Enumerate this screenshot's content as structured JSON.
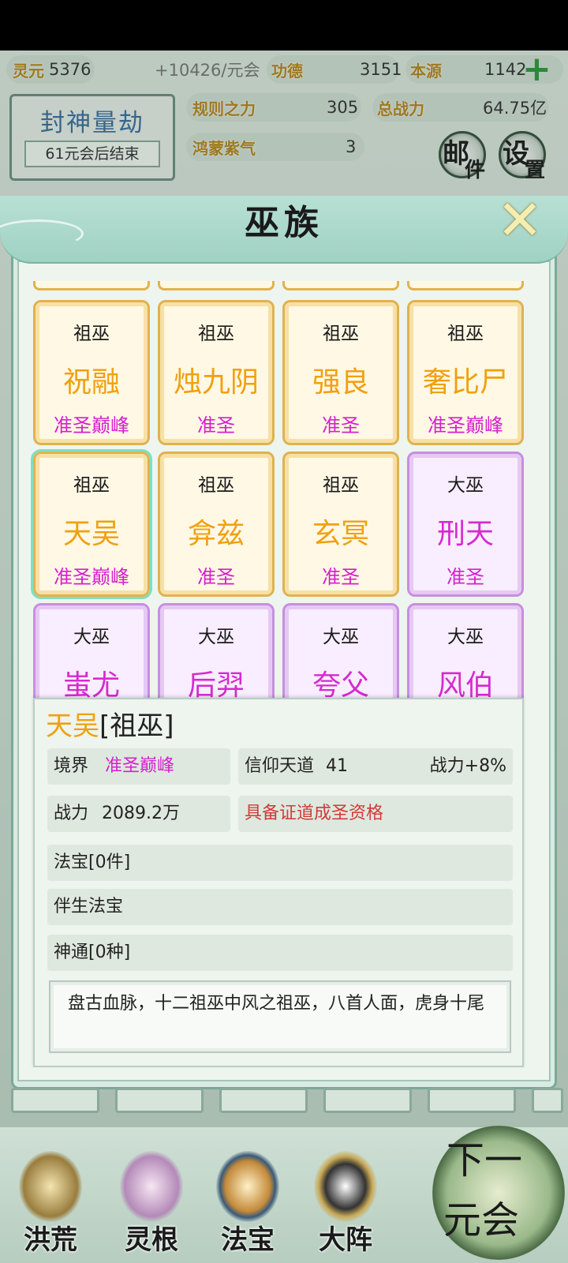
{
  "resources": {
    "lingyuan_label": "灵元",
    "lingyuan_value": "5376",
    "income": "+10426/元会",
    "gongde_label": "功德",
    "gongde_value": "3151",
    "benyuan_label": "本源",
    "benyuan_value": "1142",
    "guize_label": "规则之力",
    "guize_value": "305",
    "zongzhanli_label": "总战力",
    "zongzhanli_value": "64.75亿",
    "hongmeng_label": "鸿蒙紫气",
    "hongmeng_value": "3"
  },
  "event": {
    "title": "封神量劫",
    "subtitle": "61元会后结束"
  },
  "buttons": {
    "mail_top": "邮",
    "mail_bottom": "件",
    "settings_top": "设",
    "settings_bottom": "置",
    "close": "✕",
    "add": "+"
  },
  "modal": {
    "title": "巫族"
  },
  "cards": [
    {
      "rank": "祖巫",
      "name": "祝融",
      "level": "准圣巅峰",
      "tier": "gold"
    },
    {
      "rank": "祖巫",
      "name": "烛九阴",
      "level": "准圣",
      "tier": "gold"
    },
    {
      "rank": "祖巫",
      "name": "强良",
      "level": "准圣",
      "tier": "gold"
    },
    {
      "rank": "祖巫",
      "name": "奢比尸",
      "level": "准圣巅峰",
      "tier": "gold"
    },
    {
      "rank": "祖巫",
      "name": "天吴",
      "level": "准圣巅峰",
      "tier": "gold",
      "selected": true
    },
    {
      "rank": "祖巫",
      "name": "弇兹",
      "level": "准圣",
      "tier": "gold"
    },
    {
      "rank": "祖巫",
      "name": "玄冥",
      "level": "准圣",
      "tier": "gold"
    },
    {
      "rank": "大巫",
      "name": "刑天",
      "level": "准圣",
      "tier": "purple"
    },
    {
      "rank": "大巫",
      "name": "蚩尤",
      "level": "",
      "tier": "purple"
    },
    {
      "rank": "大巫",
      "name": "后羿",
      "level": "",
      "tier": "purple"
    },
    {
      "rank": "大巫",
      "name": "夸父",
      "level": "",
      "tier": "purple"
    },
    {
      "rank": "大巫",
      "name": "风伯",
      "level": "",
      "tier": "purple"
    }
  ],
  "detail": {
    "name": "天吴",
    "rank": "[祖巫]",
    "realm_label": "境界",
    "realm_value": "准圣巅峰",
    "faith_label": "信仰天道",
    "faith_value": "41",
    "power_bonus": "战力+8%",
    "power_label": "战力",
    "power_value": "2089.2万",
    "qualification": "具备证道成圣资格",
    "treasure": "法宝[0件]",
    "companion_treasure": "伴生法宝",
    "abilities": "神通[0种]",
    "description": "盘古血脉，十二祖巫中风之祖巫，八首人面，虎身十尾"
  },
  "nav": {
    "items": [
      "洪荒",
      "灵根",
      "法宝",
      "大阵"
    ],
    "next_top": "下一",
    "next_bottom": "元会"
  },
  "colors": {
    "gold_name": "#f0a010",
    "purple_name": "#d62ad0",
    "level": "#d51fcf",
    "qualification": "#d23a3a"
  }
}
